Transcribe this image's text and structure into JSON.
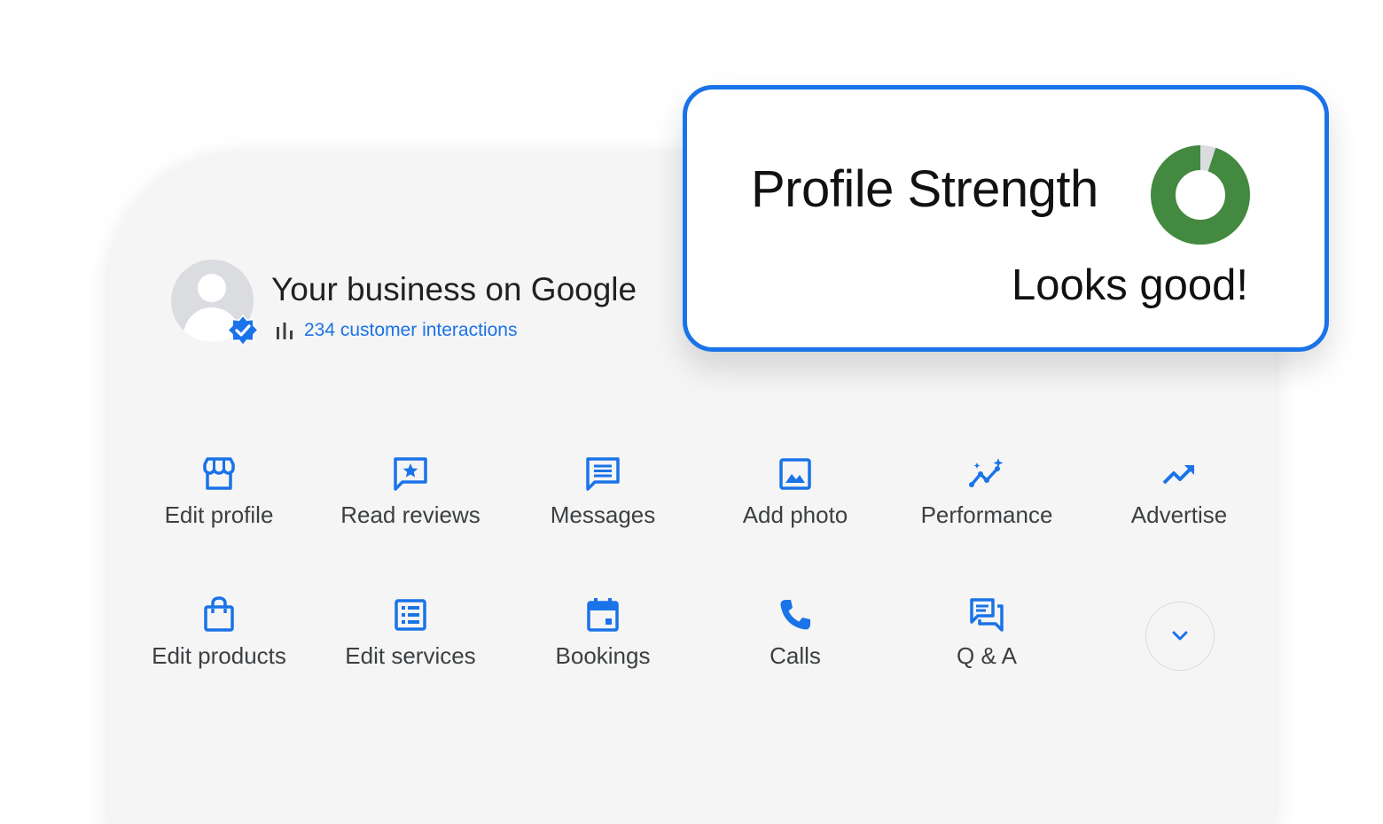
{
  "business": {
    "title": "Your business on Google",
    "interactions": "234 customer interactions"
  },
  "actions_row1": [
    {
      "label": "Edit profile",
      "icon": "storefront-icon"
    },
    {
      "label": "Read reviews",
      "icon": "review-star-icon"
    },
    {
      "label": "Messages",
      "icon": "message-icon"
    },
    {
      "label": "Add photo",
      "icon": "photo-icon"
    },
    {
      "label": "Performance",
      "icon": "insights-icon"
    },
    {
      "label": "Advertise",
      "icon": "trending-up-icon"
    }
  ],
  "actions_row2": [
    {
      "label": "Edit products",
      "icon": "shopping-bag-icon"
    },
    {
      "label": "Edit services",
      "icon": "list-icon"
    },
    {
      "label": "Bookings",
      "icon": "calendar-icon"
    },
    {
      "label": "Calls",
      "icon": "phone-icon"
    },
    {
      "label": "Q & A",
      "icon": "forum-icon"
    }
  ],
  "expand_icon": "chevron-down-icon",
  "profile_strength": {
    "title": "Profile Strength",
    "status": "Looks good!",
    "level": 0.95
  },
  "colors": {
    "accent": "#1a73e8",
    "strength_fill": "#43893f",
    "strength_track": "#dadce0",
    "panel": "#f5f5f5"
  }
}
